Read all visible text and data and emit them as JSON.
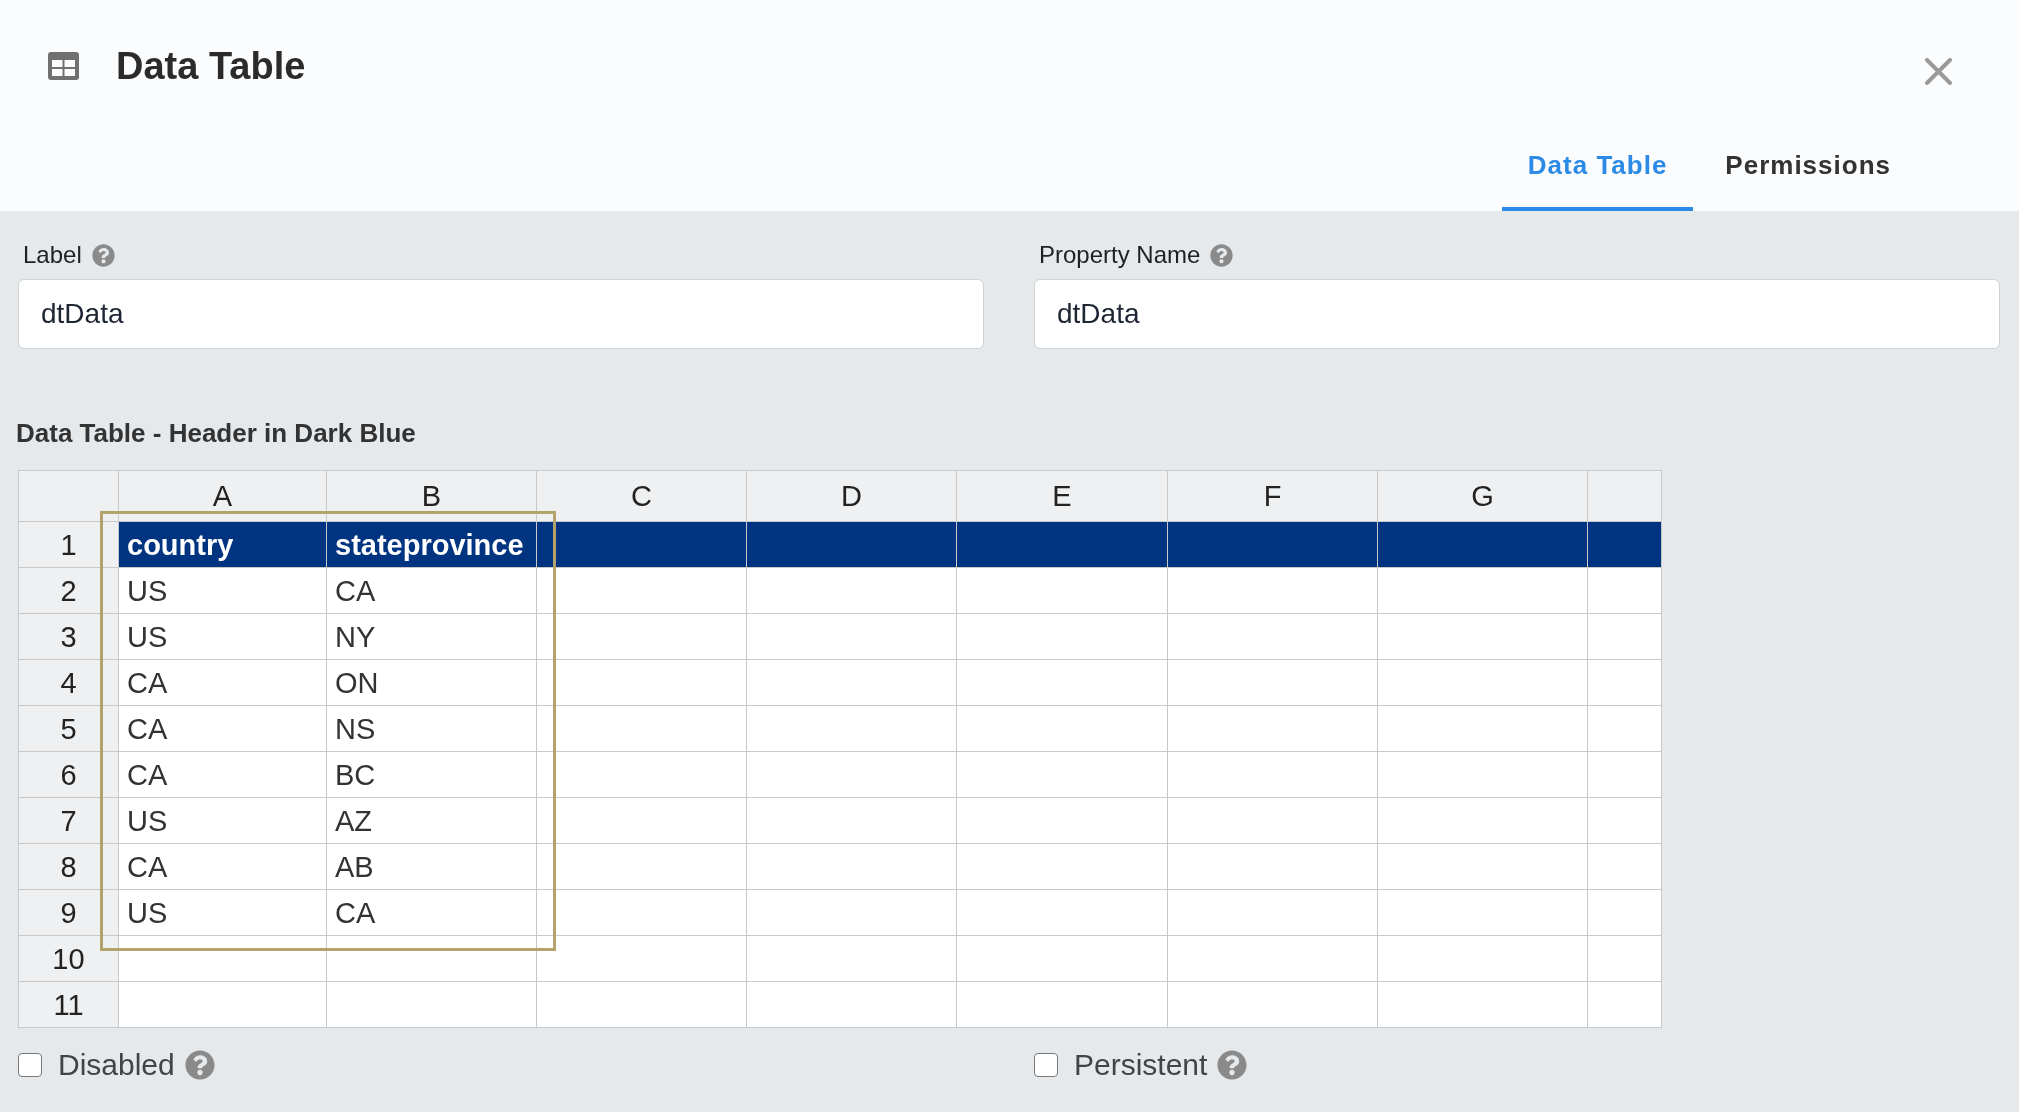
{
  "dialog": {
    "title": "Data Table"
  },
  "tabs": [
    {
      "label": "Data Table",
      "selected": true
    },
    {
      "label": "Permissions",
      "selected": false
    }
  ],
  "fields": [
    {
      "label": "Label",
      "value": "dtData"
    },
    {
      "label": "Property Name",
      "value": "dtData"
    }
  ],
  "table": {
    "title": "Data Table - Header in Dark Blue",
    "columns": [
      "A",
      "B",
      "C",
      "D",
      "E",
      "F",
      "G"
    ],
    "rows": [
      {
        "number": "1",
        "kind": "header",
        "cells": [
          "country",
          "stateprovince"
        ]
      },
      {
        "number": "2",
        "kind": "data",
        "cells": [
          "US",
          "CA"
        ]
      },
      {
        "number": "3",
        "kind": "data",
        "cells": [
          "US",
          "NY"
        ]
      },
      {
        "number": "4",
        "kind": "data",
        "cells": [
          "CA",
          "ON"
        ]
      },
      {
        "number": "5",
        "kind": "data",
        "cells": [
          "CA",
          "NS"
        ]
      },
      {
        "number": "6",
        "kind": "data",
        "cells": [
          "CA",
          "BC"
        ]
      },
      {
        "number": "7",
        "kind": "data",
        "cells": [
          "US",
          "AZ"
        ]
      },
      {
        "number": "8",
        "kind": "data",
        "cells": [
          "CA",
          "AB"
        ]
      },
      {
        "number": "9",
        "kind": "data",
        "cells": [
          "US",
          "CA"
        ]
      },
      {
        "number": "10",
        "kind": "data"
      },
      {
        "number": "11",
        "kind": "data"
      }
    ]
  },
  "options": [
    {
      "label": "Disabled",
      "checked": false
    },
    {
      "label": "Persistent",
      "checked": false
    }
  ]
}
